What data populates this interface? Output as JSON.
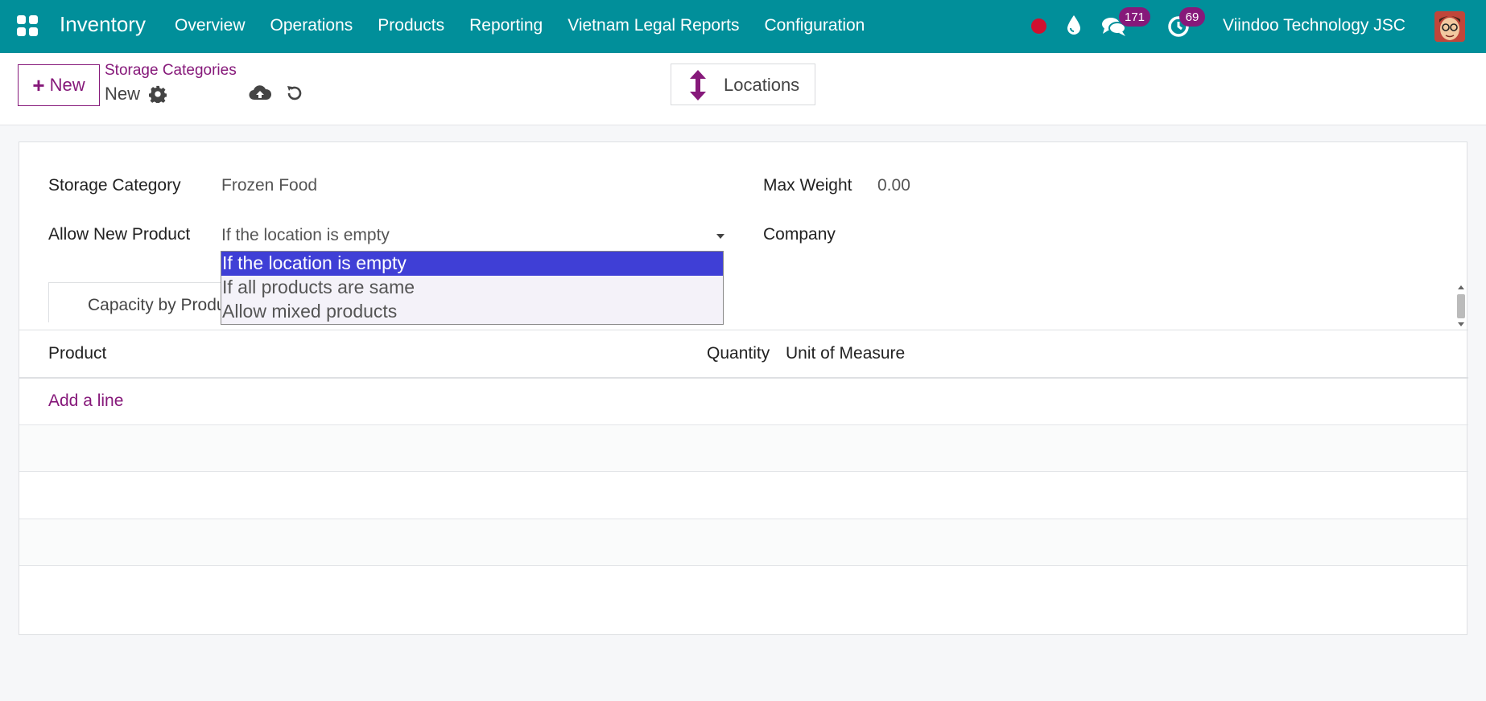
{
  "navbar": {
    "app_title": "Inventory",
    "menu": [
      "Overview",
      "Operations",
      "Products",
      "Reporting",
      "Vietnam Legal Reports",
      "Configuration"
    ],
    "messages_count": "171",
    "activities_count": "69",
    "company": "Viindoo Technology JSC",
    "color": "#018f9a"
  },
  "control": {
    "new_label": "New",
    "breadcrumb": "Storage Categories",
    "record_name": "New",
    "smart_button_label": "Locations",
    "accent": "#86197a"
  },
  "form": {
    "storage_category_label": "Storage Category",
    "storage_category_value": "Frozen Food",
    "allow_new_product_label": "Allow New Product",
    "allow_new_product_value": "If the location is empty",
    "max_weight_label": "Max Weight",
    "max_weight_value": "0.00",
    "company_label": "Company"
  },
  "tabs": {
    "capacity_by_product": "Capacity by Product"
  },
  "table": {
    "headers": [
      "Product",
      "Quantity",
      "Unit of Measure"
    ],
    "add_line": "Add a line"
  },
  "dropdown": {
    "options": [
      "If the location is empty",
      "If all products are same",
      "Allow mixed products"
    ],
    "selected_index": 0,
    "highlight_color": "#3f3fd6"
  }
}
